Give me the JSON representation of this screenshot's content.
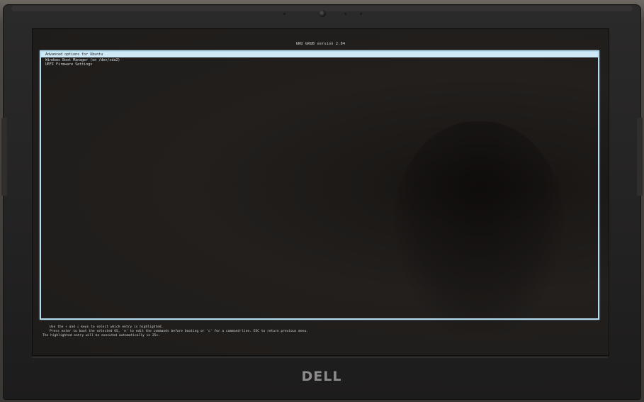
{
  "grub": {
    "title": "GNU GRUB  version 2.04",
    "menu_items": [
      {
        "label": "Advanced options for Ubuntu",
        "selected": true
      },
      {
        "label": "Windows Boot Manager (on /dev/sda2)",
        "selected": false
      },
      {
        "label": "UEFI Firmware Settings",
        "selected": false
      }
    ],
    "help": {
      "line1": "Use the ↑ and ↓ keys to select which entry is highlighted.",
      "line2": "Press enter to boot the selected OS, `e' to edit the commands before booting or `c' for a command-line. ESC to return previous menu.",
      "line3": "The highlighted entry will be executed automatically in 25s."
    }
  },
  "hardware": {
    "brand_logo": "DELL"
  },
  "colors": {
    "selection_highlight": "#cfe8f6",
    "menu_border": "#b4dcef",
    "screen_background": "#1e1c1a"
  }
}
